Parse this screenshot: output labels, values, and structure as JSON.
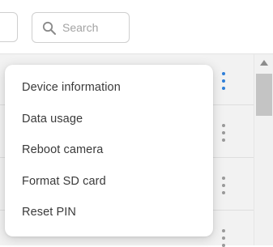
{
  "search": {
    "placeholder": "Search",
    "icon": "search-icon"
  },
  "colors": {
    "accent": "#2f7fd8",
    "menu_text": "#3a3a3a",
    "list_background": "#f2f2f2"
  },
  "menu": {
    "items": [
      {
        "label": "Device information"
      },
      {
        "label": "Data usage"
      },
      {
        "label": "Reboot camera"
      },
      {
        "label": "Format SD card"
      },
      {
        "label": "Reset PIN"
      }
    ]
  },
  "list": {
    "rows": [
      {
        "menu_icon": "more-vertical-icon",
        "active": true
      },
      {
        "menu_icon": "more-vertical-icon",
        "active": false
      },
      {
        "menu_icon": "more-vertical-icon",
        "active": false
      },
      {
        "menu_icon": "more-vertical-icon",
        "active": false
      }
    ]
  }
}
